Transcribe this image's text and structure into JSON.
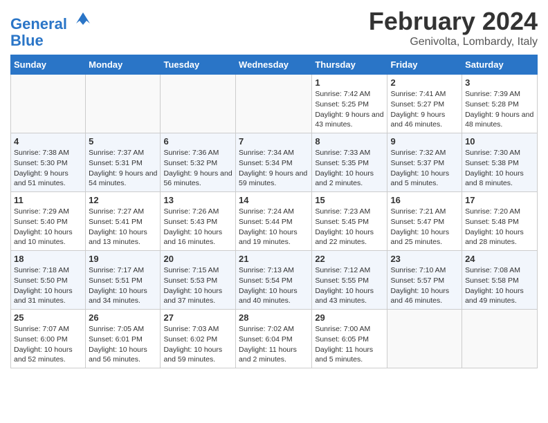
{
  "header": {
    "logo_line1": "General",
    "logo_line2": "Blue",
    "month_title": "February 2024",
    "location": "Genivolta, Lombardy, Italy"
  },
  "days_of_week": [
    "Sunday",
    "Monday",
    "Tuesday",
    "Wednesday",
    "Thursday",
    "Friday",
    "Saturday"
  ],
  "weeks": [
    {
      "days": [
        {
          "num": "",
          "info": ""
        },
        {
          "num": "",
          "info": ""
        },
        {
          "num": "",
          "info": ""
        },
        {
          "num": "",
          "info": ""
        },
        {
          "num": "1",
          "info": "Sunrise: 7:42 AM\nSunset: 5:25 PM\nDaylight: 9 hours and 43 minutes."
        },
        {
          "num": "2",
          "info": "Sunrise: 7:41 AM\nSunset: 5:27 PM\nDaylight: 9 hours and 46 minutes."
        },
        {
          "num": "3",
          "info": "Sunrise: 7:39 AM\nSunset: 5:28 PM\nDaylight: 9 hours and 48 minutes."
        }
      ]
    },
    {
      "days": [
        {
          "num": "4",
          "info": "Sunrise: 7:38 AM\nSunset: 5:30 PM\nDaylight: 9 hours and 51 minutes."
        },
        {
          "num": "5",
          "info": "Sunrise: 7:37 AM\nSunset: 5:31 PM\nDaylight: 9 hours and 54 minutes."
        },
        {
          "num": "6",
          "info": "Sunrise: 7:36 AM\nSunset: 5:32 PM\nDaylight: 9 hours and 56 minutes."
        },
        {
          "num": "7",
          "info": "Sunrise: 7:34 AM\nSunset: 5:34 PM\nDaylight: 9 hours and 59 minutes."
        },
        {
          "num": "8",
          "info": "Sunrise: 7:33 AM\nSunset: 5:35 PM\nDaylight: 10 hours and 2 minutes."
        },
        {
          "num": "9",
          "info": "Sunrise: 7:32 AM\nSunset: 5:37 PM\nDaylight: 10 hours and 5 minutes."
        },
        {
          "num": "10",
          "info": "Sunrise: 7:30 AM\nSunset: 5:38 PM\nDaylight: 10 hours and 8 minutes."
        }
      ]
    },
    {
      "days": [
        {
          "num": "11",
          "info": "Sunrise: 7:29 AM\nSunset: 5:40 PM\nDaylight: 10 hours and 10 minutes."
        },
        {
          "num": "12",
          "info": "Sunrise: 7:27 AM\nSunset: 5:41 PM\nDaylight: 10 hours and 13 minutes."
        },
        {
          "num": "13",
          "info": "Sunrise: 7:26 AM\nSunset: 5:43 PM\nDaylight: 10 hours and 16 minutes."
        },
        {
          "num": "14",
          "info": "Sunrise: 7:24 AM\nSunset: 5:44 PM\nDaylight: 10 hours and 19 minutes."
        },
        {
          "num": "15",
          "info": "Sunrise: 7:23 AM\nSunset: 5:45 PM\nDaylight: 10 hours and 22 minutes."
        },
        {
          "num": "16",
          "info": "Sunrise: 7:21 AM\nSunset: 5:47 PM\nDaylight: 10 hours and 25 minutes."
        },
        {
          "num": "17",
          "info": "Sunrise: 7:20 AM\nSunset: 5:48 PM\nDaylight: 10 hours and 28 minutes."
        }
      ]
    },
    {
      "days": [
        {
          "num": "18",
          "info": "Sunrise: 7:18 AM\nSunset: 5:50 PM\nDaylight: 10 hours and 31 minutes."
        },
        {
          "num": "19",
          "info": "Sunrise: 7:17 AM\nSunset: 5:51 PM\nDaylight: 10 hours and 34 minutes."
        },
        {
          "num": "20",
          "info": "Sunrise: 7:15 AM\nSunset: 5:53 PM\nDaylight: 10 hours and 37 minutes."
        },
        {
          "num": "21",
          "info": "Sunrise: 7:13 AM\nSunset: 5:54 PM\nDaylight: 10 hours and 40 minutes."
        },
        {
          "num": "22",
          "info": "Sunrise: 7:12 AM\nSunset: 5:55 PM\nDaylight: 10 hours and 43 minutes."
        },
        {
          "num": "23",
          "info": "Sunrise: 7:10 AM\nSunset: 5:57 PM\nDaylight: 10 hours and 46 minutes."
        },
        {
          "num": "24",
          "info": "Sunrise: 7:08 AM\nSunset: 5:58 PM\nDaylight: 10 hours and 49 minutes."
        }
      ]
    },
    {
      "days": [
        {
          "num": "25",
          "info": "Sunrise: 7:07 AM\nSunset: 6:00 PM\nDaylight: 10 hours and 52 minutes."
        },
        {
          "num": "26",
          "info": "Sunrise: 7:05 AM\nSunset: 6:01 PM\nDaylight: 10 hours and 56 minutes."
        },
        {
          "num": "27",
          "info": "Sunrise: 7:03 AM\nSunset: 6:02 PM\nDaylight: 10 hours and 59 minutes."
        },
        {
          "num": "28",
          "info": "Sunrise: 7:02 AM\nSunset: 6:04 PM\nDaylight: 11 hours and 2 minutes."
        },
        {
          "num": "29",
          "info": "Sunrise: 7:00 AM\nSunset: 6:05 PM\nDaylight: 11 hours and 5 minutes."
        },
        {
          "num": "",
          "info": ""
        },
        {
          "num": "",
          "info": ""
        }
      ]
    }
  ]
}
